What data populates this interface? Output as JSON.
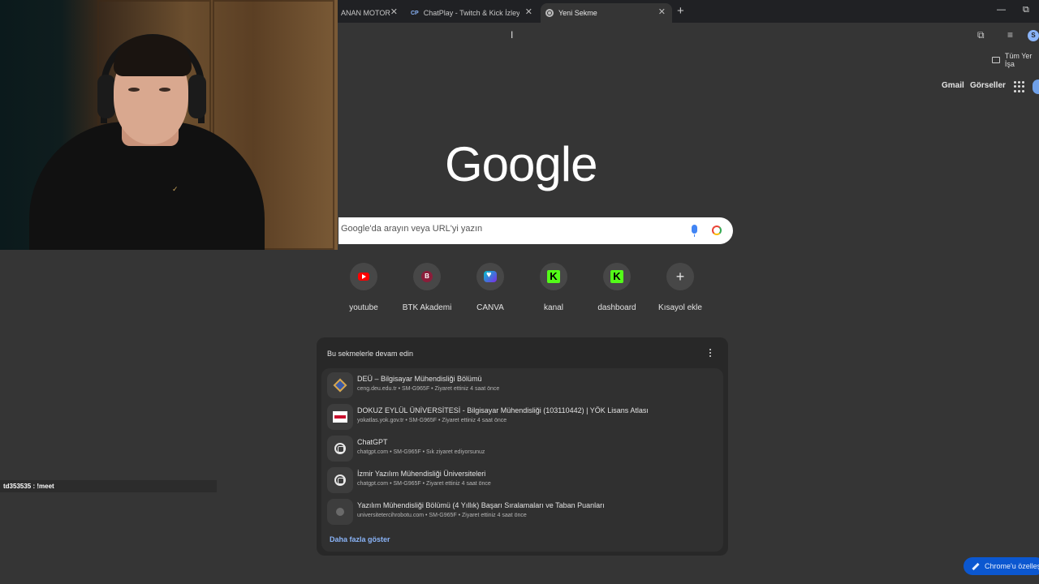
{
  "tabs": [
    {
      "title": "ANAN MOTOR",
      "active": false
    },
    {
      "title": "ChatPlay - Twitch & Kick İzleyic",
      "favicon": "CP",
      "active": false
    },
    {
      "title": "Yeni Sekme",
      "active": true
    }
  ],
  "tab_close_glyph": "✕",
  "new_tab_glyph": "+",
  "window_controls": {
    "minimize": "—",
    "restore": "⧉"
  },
  "toolbar": {
    "profile_initial": "S"
  },
  "bookmarks": {
    "all_bookmarks": "Tüm Yer İşa"
  },
  "top_links": {
    "gmail": "Gmail",
    "images": "Görseller"
  },
  "logo": "Google",
  "search": {
    "placeholder": "Google'da arayın veya URL'yi yazın"
  },
  "shortcuts": [
    {
      "label": "youtube",
      "icon": "youtube-icon"
    },
    {
      "label": "BTK Akademi",
      "icon": "btk-icon",
      "glyph": "B"
    },
    {
      "label": "CANVA",
      "icon": "canva-icon"
    },
    {
      "label": "kanal",
      "icon": "kick-icon",
      "glyph": "K"
    },
    {
      "label": "dashboard",
      "icon": "kick-icon",
      "glyph": "K"
    },
    {
      "label": "Kısayol ekle",
      "icon": "plus-icon",
      "glyph": "+"
    }
  ],
  "continue": {
    "title": "Bu sekmelerle devam edin",
    "items": [
      {
        "title": "DEÜ – Bilgisayar Mühendisliği Bölümü",
        "meta": "ceng.deu.edu.tr • SM-G965F • Ziyaret ettiniz 4 saat önce"
      },
      {
        "title": "DOKUZ EYLÜL ÜNİVERSİTESİ - Bilgisayar Mühendisliği (103110442) | YÖK Lisans Atlası",
        "meta": "yokatlas.yok.gov.tr • SM-G965F • Ziyaret ettiniz 4 saat önce"
      },
      {
        "title": "ChatGPT",
        "meta": "chatgpt.com • SM-G965F • Sık ziyaret ediyorsunuz"
      },
      {
        "title": "İzmir Yazılım Mühendisliği Üniversiteleri",
        "meta": "chatgpt.com • SM-G965F • Ziyaret ettiniz 4 saat önce"
      },
      {
        "title": "Yazılım Mühendisliği Bölümü (4 Yıllık) Başarı Sıralamaları ve Taban Puanları",
        "meta": "universitetercihrobotu.com • SM-G965F • Ziyaret ettiniz 4 saat önce"
      }
    ],
    "show_more": "Daha fazla göster"
  },
  "chat_overlay": {
    "message": "td353535 : !meet"
  },
  "customize": {
    "label": "Chrome'u özelleştir"
  }
}
